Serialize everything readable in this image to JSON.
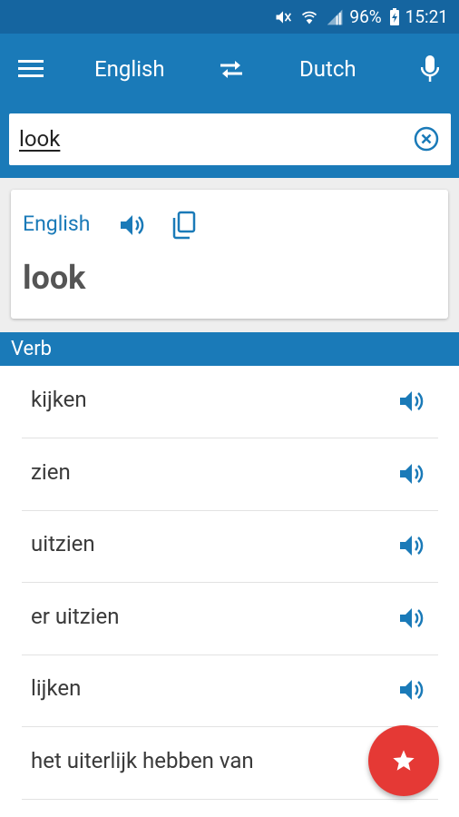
{
  "status_bar": {
    "battery_percent": "96%",
    "time": "15:21"
  },
  "toolbar": {
    "source_language": "English",
    "target_language": "Dutch"
  },
  "search": {
    "value": "look"
  },
  "result_card": {
    "language": "English",
    "word": "look"
  },
  "section": {
    "title": "Verb"
  },
  "translations": [
    "kijken",
    "zien",
    "uitzien",
    "er uitzien",
    "lijken",
    "het uiterlijk hebben van"
  ],
  "colors": {
    "primary": "#1a7ab8",
    "status_bar": "#1565a0",
    "fab": "#e53935"
  }
}
